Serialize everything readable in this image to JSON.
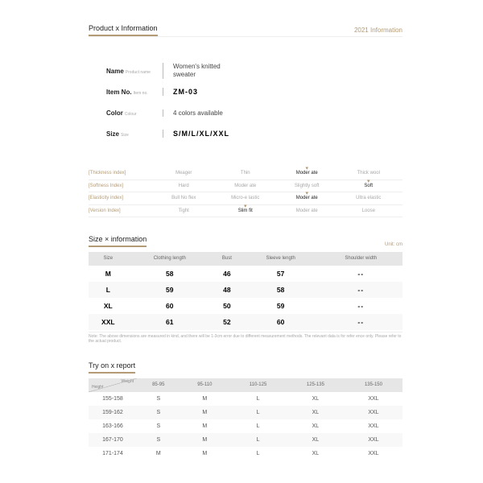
{
  "header": {
    "title": "Product x Information",
    "tag": "2021 Information"
  },
  "info": {
    "nameLabel": "Name",
    "nameSub": "Product name",
    "nameVal": "Women's knitted sweater",
    "itemLabel": "Item No.",
    "itemSub": "Item no.",
    "itemVal": "ZM-03",
    "colorLabel": "Color",
    "colorSub": "Colour",
    "colorVal": "4 colors available",
    "sizeLabel": "Size",
    "sizeSub": "Size",
    "sizeVal": "S/M/L/XL/XXL"
  },
  "idx": {
    "r1": {
      "lbl": "[Thickness index]",
      "o": [
        "Meager",
        "Thin",
        "Moder ate",
        "Thick wool"
      ],
      "sel": 2
    },
    "r2": {
      "lbl": "[Softness Index]",
      "o": [
        "Hard",
        "Moder ate",
        "Slightly soft",
        "Soft"
      ],
      "sel": 3
    },
    "r3": {
      "lbl": "[Elasticity index]",
      "o": [
        "Bull No flex",
        "Micro-e lastic",
        "Moder ate",
        "Ultra elastic"
      ],
      "sel": 2
    },
    "r4": {
      "lbl": "[Version Index]",
      "o": [
        "Tight",
        "Slim fit",
        "Moder ate",
        "Loose"
      ],
      "sel": 1
    }
  },
  "size": {
    "title": "Size × information",
    "unit": "Unit: cm",
    "cols": [
      "Size",
      "Clothing length",
      "Bust",
      "Sleeve length",
      "Shoulder width"
    ],
    "rows": [
      [
        "M",
        "58",
        "46",
        "57",
        "--"
      ],
      [
        "L",
        "59",
        "48",
        "58",
        "--"
      ],
      [
        "XL",
        "60",
        "50",
        "59",
        "--"
      ],
      [
        "XXL",
        "61",
        "52",
        "60",
        "--"
      ]
    ],
    "note": "Note: The above dimensions are measured in kind, and there will be 1-3cm error due to different measurement methods. The relevant data is for refer ence only. Please refer to the actual product."
  },
  "tryon": {
    "title": "Try on x report",
    "wLabel": "Weight",
    "hLabel": "Height",
    "cols": [
      "85-95",
      "95-110",
      "110-125",
      "125-135",
      "135-150"
    ],
    "rows": [
      [
        "155-158",
        "S",
        "M",
        "L",
        "XL",
        "XXL"
      ],
      [
        "159-162",
        "S",
        "M",
        "L",
        "XL",
        "XXL"
      ],
      [
        "163-166",
        "S",
        "M",
        "L",
        "XL",
        "XXL"
      ],
      [
        "167-170",
        "S",
        "M",
        "L",
        "XL",
        "XXL"
      ],
      [
        "171-174",
        "M",
        "M",
        "L",
        "XL",
        "XXL"
      ]
    ]
  }
}
